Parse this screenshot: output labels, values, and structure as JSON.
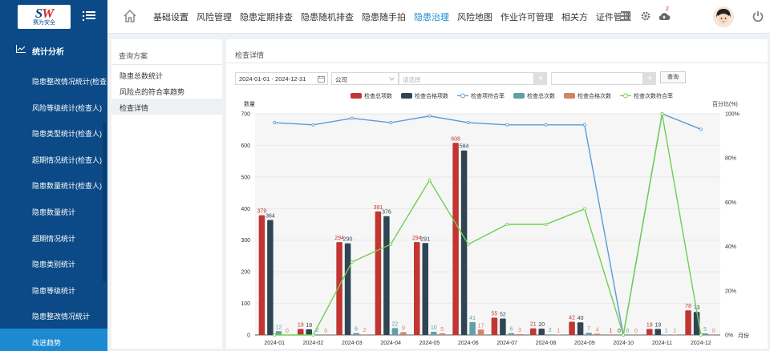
{
  "header": {
    "logo_mark": "SW",
    "logo_text": "赛为安全",
    "nav": [
      "基础设置",
      "风险管理",
      "隐患定期排查",
      "隐患随机排查",
      "隐患随手拍",
      "隐患治理",
      "风险地图",
      "作业许可管理",
      "相关方",
      "证件管理"
    ],
    "active_nav": "隐患治理",
    "notification_count": "2",
    "accent": "#1b8ad1"
  },
  "sidebar": {
    "section": "统计分析",
    "items": [
      {
        "label": "隐患整改情况统计(检查..."
      },
      {
        "label": "风险等级统计(检查人)"
      },
      {
        "label": "隐患类型统计(检查人)"
      },
      {
        "label": "超期情况统计(检查人)"
      },
      {
        "label": "隐患数量统计(检查人)"
      },
      {
        "label": "隐患数量统计"
      },
      {
        "label": "超期情况统计"
      },
      {
        "label": "隐患类别统计"
      },
      {
        "label": "隐患等级统计"
      },
      {
        "label": "隐患整改情况统计"
      },
      {
        "label": "改进趋势"
      }
    ],
    "active_item": "改进趋势",
    "color": "#0b4a86"
  },
  "left_panel": {
    "title": "查询方案",
    "items": [
      {
        "label": "隐患总数统计"
      },
      {
        "label": "风险点的符合率趋势"
      },
      {
        "label": "检查详情"
      }
    ],
    "active_item": "检查详情"
  },
  "main": {
    "title": "检查详情",
    "filters": {
      "date_range": "2024-01-01 - 2024-12-31",
      "company_select": "公司",
      "selector_placeholder": "请选择",
      "query_button": "查询"
    }
  },
  "chart_data": {
    "type": "bar",
    "categories": [
      "2024-01",
      "2024-02",
      "2024-03",
      "2024-04",
      "2024-05",
      "2024-06",
      "2024-07",
      "2024-08",
      "2024-09",
      "2024-10",
      "2024-11",
      "2024-12"
    ],
    "ylabel": "数量",
    "y2label": "百分比(%)",
    "xlabel": "月份",
    "ylim": [
      0,
      700
    ],
    "y_ticks": [
      0,
      100,
      200,
      300,
      400,
      500,
      600,
      700
    ],
    "y2lim": [
      0,
      100
    ],
    "y2_ticks": [
      "0%",
      "20%",
      "40%",
      "60%",
      "80%",
      "100%"
    ],
    "legend_position": "top",
    "grid": true,
    "series": [
      {
        "name": "检查总项数",
        "type": "bar",
        "color": "#c23531",
        "label_color": "#c23531",
        "values": [
          379,
          19,
          294,
          391,
          294,
          608,
          55,
          21,
          42,
          1,
          19,
          78
        ]
      },
      {
        "name": "检查合格项数",
        "type": "bar",
        "color": "#2f4554",
        "label_color": "#2f4554",
        "values": [
          364,
          18,
          290,
          376,
          291,
          584,
          52,
          20,
          40,
          0,
          19,
          73
        ]
      },
      {
        "name": "检查项符合率",
        "type": "line",
        "axis": "right",
        "color": "#5b9bd5",
        "values": [
          96,
          95,
          98,
          96,
          99,
          96,
          95,
          95,
          95,
          0,
          100,
          93
        ]
      },
      {
        "name": "检查总次数",
        "type": "bar",
        "color": "#61a0a8",
        "label_color": "#61a0a8",
        "values": [
          12,
          2,
          6,
          22,
          10,
          41,
          6,
          2,
          7,
          0,
          1,
          5
        ]
      },
      {
        "name": "检查合格次数",
        "type": "bar",
        "color": "#d48265",
        "label_color": "#d48265",
        "values": [
          0,
          0,
          2,
          9,
          5,
          17,
          3,
          1,
          4,
          0,
          1,
          0
        ]
      },
      {
        "name": "检查次数符合率",
        "type": "line",
        "axis": "right",
        "color": "#6fcf4f",
        "values": [
          0,
          0,
          33,
          41,
          70,
          41,
          50,
          50,
          57,
          0,
          100,
          0
        ]
      }
    ]
  }
}
